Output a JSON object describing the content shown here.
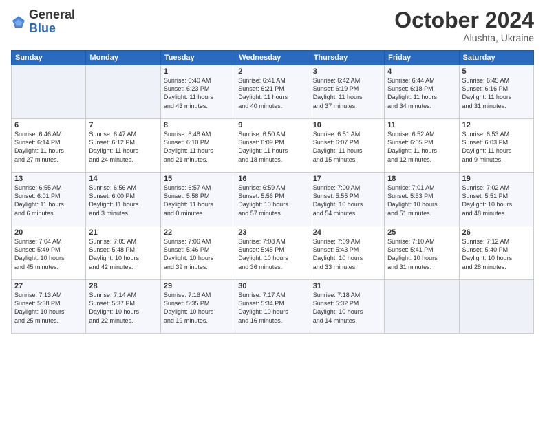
{
  "header": {
    "logo": {
      "general": "General",
      "blue": "Blue"
    },
    "title": "October 2024",
    "location": "Alushta, Ukraine"
  },
  "weekdays": [
    "Sunday",
    "Monday",
    "Tuesday",
    "Wednesday",
    "Thursday",
    "Friday",
    "Saturday"
  ],
  "weeks": [
    [
      {
        "day": "",
        "text": ""
      },
      {
        "day": "",
        "text": ""
      },
      {
        "day": "1",
        "text": "Sunrise: 6:40 AM\nSunset: 6:23 PM\nDaylight: 11 hours\nand 43 minutes."
      },
      {
        "day": "2",
        "text": "Sunrise: 6:41 AM\nSunset: 6:21 PM\nDaylight: 11 hours\nand 40 minutes."
      },
      {
        "day": "3",
        "text": "Sunrise: 6:42 AM\nSunset: 6:19 PM\nDaylight: 11 hours\nand 37 minutes."
      },
      {
        "day": "4",
        "text": "Sunrise: 6:44 AM\nSunset: 6:18 PM\nDaylight: 11 hours\nand 34 minutes."
      },
      {
        "day": "5",
        "text": "Sunrise: 6:45 AM\nSunset: 6:16 PM\nDaylight: 11 hours\nand 31 minutes."
      }
    ],
    [
      {
        "day": "6",
        "text": "Sunrise: 6:46 AM\nSunset: 6:14 PM\nDaylight: 11 hours\nand 27 minutes."
      },
      {
        "day": "7",
        "text": "Sunrise: 6:47 AM\nSunset: 6:12 PM\nDaylight: 11 hours\nand 24 minutes."
      },
      {
        "day": "8",
        "text": "Sunrise: 6:48 AM\nSunset: 6:10 PM\nDaylight: 11 hours\nand 21 minutes."
      },
      {
        "day": "9",
        "text": "Sunrise: 6:50 AM\nSunset: 6:09 PM\nDaylight: 11 hours\nand 18 minutes."
      },
      {
        "day": "10",
        "text": "Sunrise: 6:51 AM\nSunset: 6:07 PM\nDaylight: 11 hours\nand 15 minutes."
      },
      {
        "day": "11",
        "text": "Sunrise: 6:52 AM\nSunset: 6:05 PM\nDaylight: 11 hours\nand 12 minutes."
      },
      {
        "day": "12",
        "text": "Sunrise: 6:53 AM\nSunset: 6:03 PM\nDaylight: 11 hours\nand 9 minutes."
      }
    ],
    [
      {
        "day": "13",
        "text": "Sunrise: 6:55 AM\nSunset: 6:01 PM\nDaylight: 11 hours\nand 6 minutes."
      },
      {
        "day": "14",
        "text": "Sunrise: 6:56 AM\nSunset: 6:00 PM\nDaylight: 11 hours\nand 3 minutes."
      },
      {
        "day": "15",
        "text": "Sunrise: 6:57 AM\nSunset: 5:58 PM\nDaylight: 11 hours\nand 0 minutes."
      },
      {
        "day": "16",
        "text": "Sunrise: 6:59 AM\nSunset: 5:56 PM\nDaylight: 10 hours\nand 57 minutes."
      },
      {
        "day": "17",
        "text": "Sunrise: 7:00 AM\nSunset: 5:55 PM\nDaylight: 10 hours\nand 54 minutes."
      },
      {
        "day": "18",
        "text": "Sunrise: 7:01 AM\nSunset: 5:53 PM\nDaylight: 10 hours\nand 51 minutes."
      },
      {
        "day": "19",
        "text": "Sunrise: 7:02 AM\nSunset: 5:51 PM\nDaylight: 10 hours\nand 48 minutes."
      }
    ],
    [
      {
        "day": "20",
        "text": "Sunrise: 7:04 AM\nSunset: 5:49 PM\nDaylight: 10 hours\nand 45 minutes."
      },
      {
        "day": "21",
        "text": "Sunrise: 7:05 AM\nSunset: 5:48 PM\nDaylight: 10 hours\nand 42 minutes."
      },
      {
        "day": "22",
        "text": "Sunrise: 7:06 AM\nSunset: 5:46 PM\nDaylight: 10 hours\nand 39 minutes."
      },
      {
        "day": "23",
        "text": "Sunrise: 7:08 AM\nSunset: 5:45 PM\nDaylight: 10 hours\nand 36 minutes."
      },
      {
        "day": "24",
        "text": "Sunrise: 7:09 AM\nSunset: 5:43 PM\nDaylight: 10 hours\nand 33 minutes."
      },
      {
        "day": "25",
        "text": "Sunrise: 7:10 AM\nSunset: 5:41 PM\nDaylight: 10 hours\nand 31 minutes."
      },
      {
        "day": "26",
        "text": "Sunrise: 7:12 AM\nSunset: 5:40 PM\nDaylight: 10 hours\nand 28 minutes."
      }
    ],
    [
      {
        "day": "27",
        "text": "Sunrise: 7:13 AM\nSunset: 5:38 PM\nDaylight: 10 hours\nand 25 minutes."
      },
      {
        "day": "28",
        "text": "Sunrise: 7:14 AM\nSunset: 5:37 PM\nDaylight: 10 hours\nand 22 minutes."
      },
      {
        "day": "29",
        "text": "Sunrise: 7:16 AM\nSunset: 5:35 PM\nDaylight: 10 hours\nand 19 minutes."
      },
      {
        "day": "30",
        "text": "Sunrise: 7:17 AM\nSunset: 5:34 PM\nDaylight: 10 hours\nand 16 minutes."
      },
      {
        "day": "31",
        "text": "Sunrise: 7:18 AM\nSunset: 5:32 PM\nDaylight: 10 hours\nand 14 minutes."
      },
      {
        "day": "",
        "text": ""
      },
      {
        "day": "",
        "text": ""
      }
    ]
  ]
}
